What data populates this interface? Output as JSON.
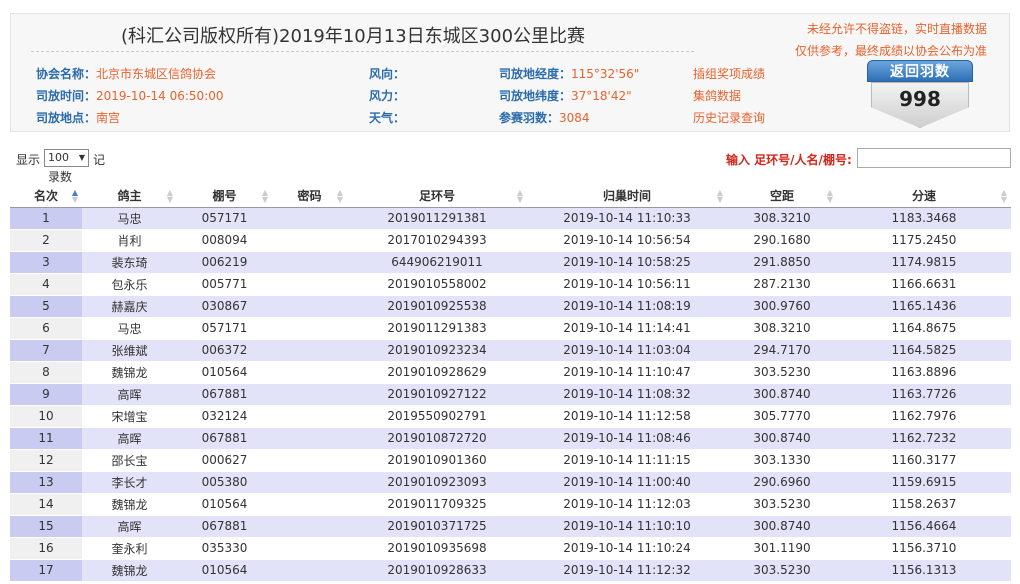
{
  "header": {
    "title": "(科汇公司版权所有)2019年10月13日东城区300公里比赛",
    "notice1": "未经允许不得盗链，实时直播数据",
    "notice2": "仅供参考，最终成绩以协会公布为准",
    "association_label": "协会名称：",
    "association_value": "北京市东城区信鸽协会",
    "release_time_label": "司放时间：",
    "release_time_value": "2019-10-14 06:50:00",
    "release_place_label": "司放地点：",
    "release_place_value": "南宫",
    "wind_dir_label": "风向：",
    "wind_dir_value": "",
    "wind_force_label": "风力：",
    "wind_force_value": "",
    "weather_label": "天气：",
    "weather_value": "",
    "longitude_label": "司放地经度：",
    "longitude_value": "115°32'56\"",
    "latitude_label": "司放地纬度：",
    "latitude_value": "37°18'42\"",
    "entries_label": "参赛羽数：",
    "entries_value": "3084",
    "link_prize": "插组奖项成绩",
    "link_group": "集鸽数据",
    "link_history": "历史记录查询",
    "return_label": "返回羽数",
    "return_value": "998"
  },
  "controls": {
    "show_label": "显示",
    "page_size": "100",
    "records_label": "记",
    "records_label2": "录数",
    "search_label": "输入 足环号/人名/棚号:",
    "search_value": ""
  },
  "table": {
    "columns": [
      "名次",
      "鸽主",
      "棚号",
      "密码",
      "足环号",
      "归巢时间",
      "空距",
      "分速"
    ],
    "rows": [
      [
        "1",
        "马忠",
        "057171",
        "",
        "2019011291381",
        "2019-10-14 11:10:33",
        "308.3210",
        "1183.3468"
      ],
      [
        "2",
        "肖利",
        "008094",
        "",
        "2017010294393",
        "2019-10-14 10:56:54",
        "290.1680",
        "1175.2450"
      ],
      [
        "3",
        "裴东琦",
        "006219",
        "",
        "644906219011",
        "2019-10-14 10:58:25",
        "291.8850",
        "1174.9815"
      ],
      [
        "4",
        "包永乐",
        "005771",
        "",
        "2019010558002",
        "2019-10-14 10:56:11",
        "287.2130",
        "1166.6631"
      ],
      [
        "5",
        "赫嘉庆",
        "030867",
        "",
        "2019010925538",
        "2019-10-14 11:08:19",
        "300.9760",
        "1165.1436"
      ],
      [
        "6",
        "马忠",
        "057171",
        "",
        "2019011291383",
        "2019-10-14 11:14:41",
        "308.3210",
        "1164.8675"
      ],
      [
        "7",
        "张维斌",
        "006372",
        "",
        "2019010923234",
        "2019-10-14 11:03:04",
        "294.7170",
        "1164.5825"
      ],
      [
        "8",
        "魏锦龙",
        "010564",
        "",
        "2019010928629",
        "2019-10-14 11:10:47",
        "303.5230",
        "1163.8896"
      ],
      [
        "9",
        "高晖",
        "067881",
        "",
        "2019010927122",
        "2019-10-14 11:08:32",
        "300.8740",
        "1163.7726"
      ],
      [
        "10",
        "宋增宝",
        "032124",
        "",
        "2019550902791",
        "2019-10-14 11:12:58",
        "305.7770",
        "1162.7976"
      ],
      [
        "11",
        "高晖",
        "067881",
        "",
        "2019010872720",
        "2019-10-14 11:08:46",
        "300.8740",
        "1162.7232"
      ],
      [
        "12",
        "邵长宝",
        "000627",
        "",
        "2019010901360",
        "2019-10-14 11:11:15",
        "303.1330",
        "1160.3177"
      ],
      [
        "13",
        "李长才",
        "005380",
        "",
        "2019010923093",
        "2019-10-14 11:00:40",
        "290.6960",
        "1159.6915"
      ],
      [
        "14",
        "魏锦龙",
        "010564",
        "",
        "2019011709325",
        "2019-10-14 11:12:03",
        "303.5230",
        "1158.2637"
      ],
      [
        "15",
        "高晖",
        "067881",
        "",
        "2019010371725",
        "2019-10-14 11:10:10",
        "300.8740",
        "1156.4664"
      ],
      [
        "16",
        "奎永利",
        "035330",
        "",
        "2019010935698",
        "2019-10-14 11:10:24",
        "301.1190",
        "1156.3710"
      ],
      [
        "17",
        "魏锦龙",
        "010564",
        "",
        "2019010928633",
        "2019-10-14 11:12:32",
        "303.5230",
        "1156.1313"
      ]
    ]
  }
}
